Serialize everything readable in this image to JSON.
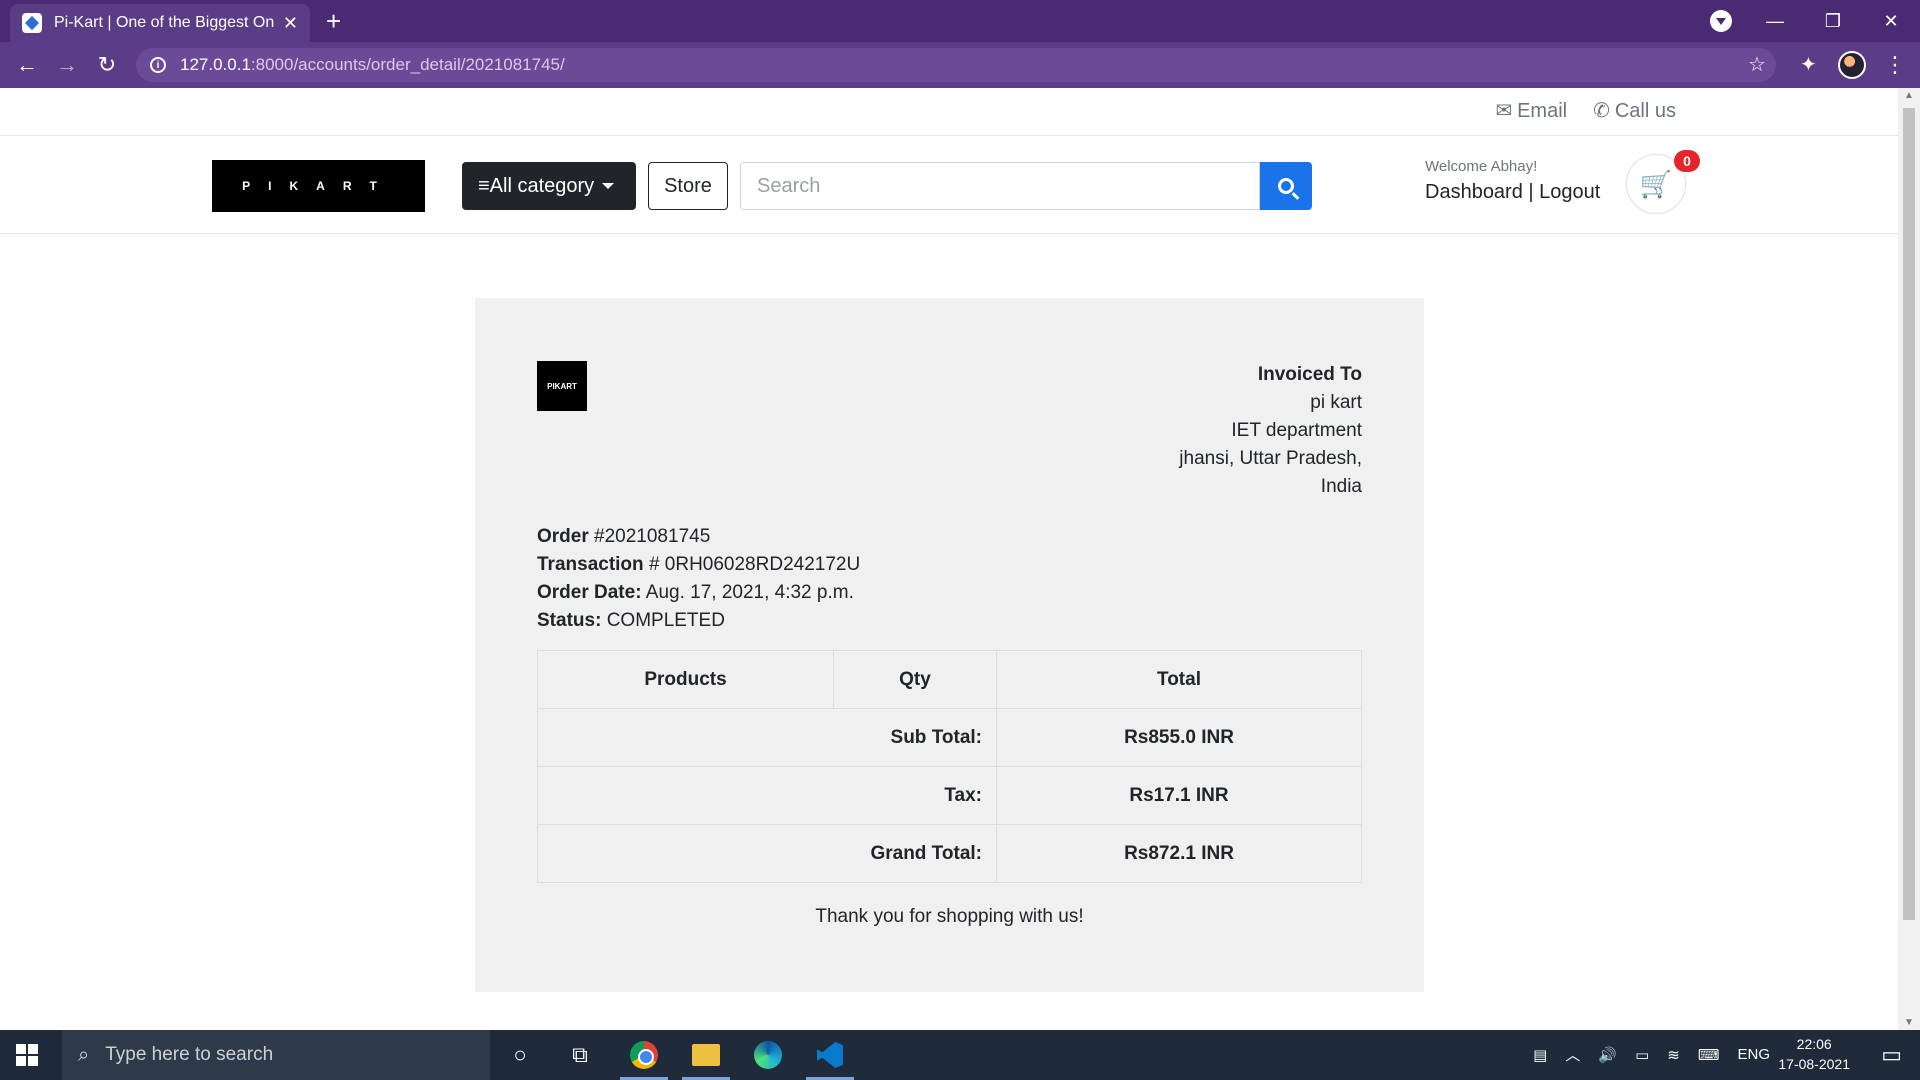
{
  "browser": {
    "tab_title": "Pi-Kart | One of the Biggest Onlin",
    "url_host": "127.0.0.1",
    "url_path": ":8000/accounts/order_detail/2021081745/"
  },
  "topbar": {
    "email": "Email",
    "call": "Call us"
  },
  "header": {
    "logo_text": "PIKART",
    "category_label": "All category",
    "store_label": "Store",
    "search_placeholder": "Search",
    "welcome": "Welcome Abhay!",
    "dashboard": "Dashboard",
    "separator": "|",
    "logout": "Logout",
    "cart_count": "0"
  },
  "invoice": {
    "logo_text": "PIKART",
    "invoiced_to_heading": "Invoiced To",
    "address": [
      "pi kart",
      "IET department",
      "jhansi, Uttar Pradesh,",
      "India"
    ],
    "order_label": "Order",
    "order_number": "#2021081745",
    "transaction_label": "Transaction",
    "transaction_id": "# 0RH06028RD242172U",
    "date_label": "Order Date:",
    "date_value": "Aug. 17, 2021, 4:32 p.m.",
    "status_label": "Status:",
    "status_value": "COMPLETED",
    "columns": [
      "Products",
      "Qty",
      "Total"
    ],
    "subtotal_label": "Sub Total:",
    "subtotal_value": "Rs855.0 INR",
    "tax_label": "Tax:",
    "tax_value": "Rs17.1 INR",
    "grand_label": "Grand Total:",
    "grand_value": "Rs872.1 INR",
    "thanks": "Thank you for shopping with us!"
  },
  "taskbar": {
    "search_placeholder": "Type here to search",
    "lang": "ENG",
    "time": "22:06",
    "date": "17-08-2021"
  }
}
